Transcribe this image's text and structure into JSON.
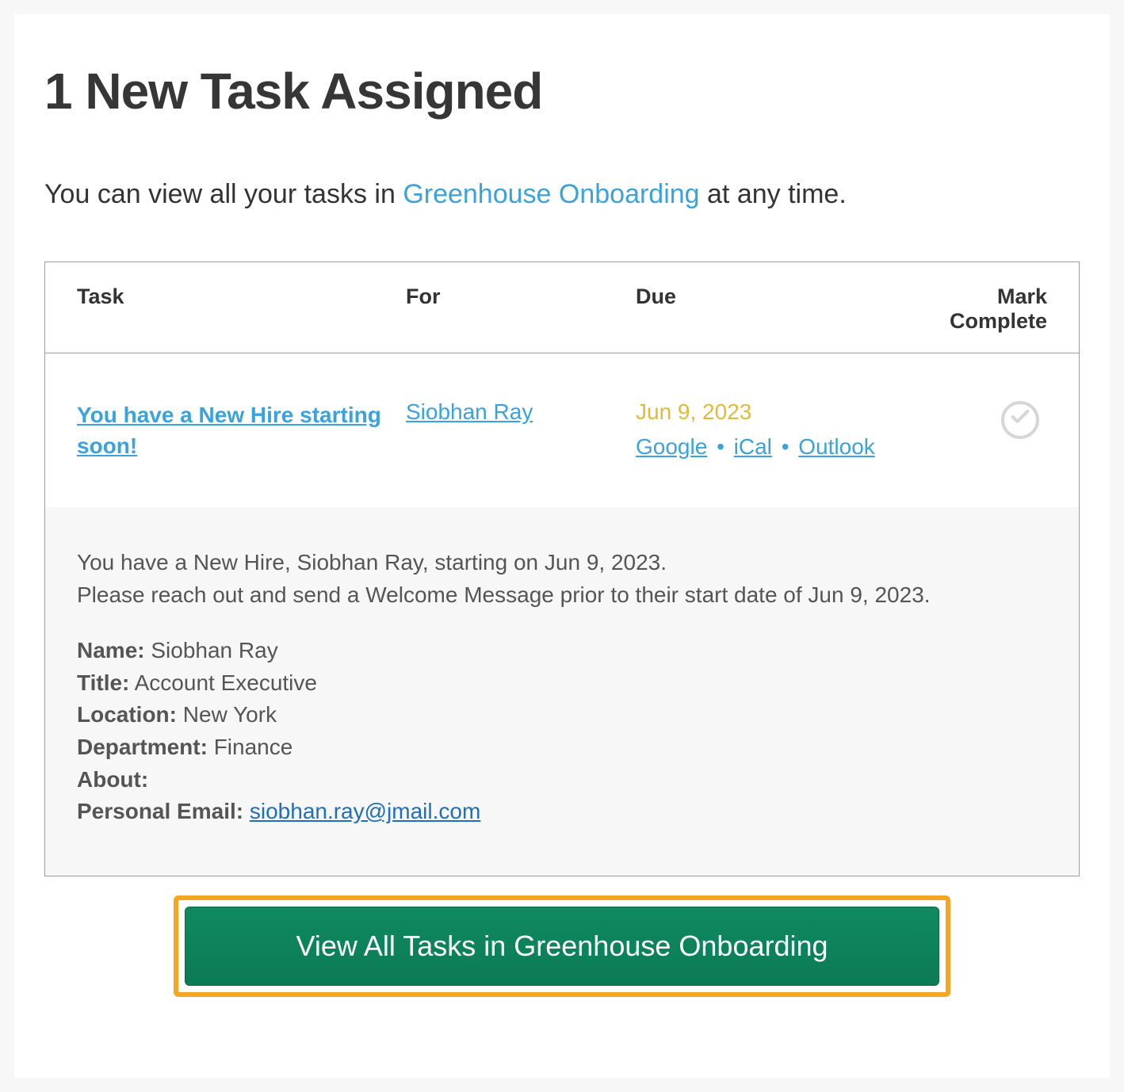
{
  "header": {
    "title": "1 New Task Assigned"
  },
  "intro": {
    "prefix": "You can view all your tasks in ",
    "link_text": "Greenhouse Onboarding",
    "suffix": " at any time."
  },
  "table": {
    "headers": {
      "task": "Task",
      "for": "For",
      "due": "Due",
      "mark": "Mark Complete"
    },
    "row": {
      "task_name": "You have a New Hire starting soon!",
      "for_name": "Siobhan Ray",
      "due_date": "Jun 9, 2023",
      "calendar": {
        "google": "Google",
        "ical": "iCal",
        "outlook": "Outlook",
        "sep": "•"
      }
    }
  },
  "details": {
    "line1": "You have a New Hire, Siobhan Ray, starting on Jun 9, 2023.",
    "line2": "Please reach out and send a Welcome Message prior to their start date of Jun 9, 2023.",
    "name_label": "Name:",
    "name_value": "Siobhan Ray",
    "title_label": "Title:",
    "title_value": "Account Executive",
    "location_label": "Location:",
    "location_value": "New York",
    "department_label": "Department:",
    "department_value": "Finance",
    "about_label": "About:",
    "about_value": "",
    "email_label": "Personal Email:",
    "email_value": "siobhan.ray@jmail.com"
  },
  "cta": {
    "label": "View All Tasks in Greenhouse Onboarding"
  }
}
